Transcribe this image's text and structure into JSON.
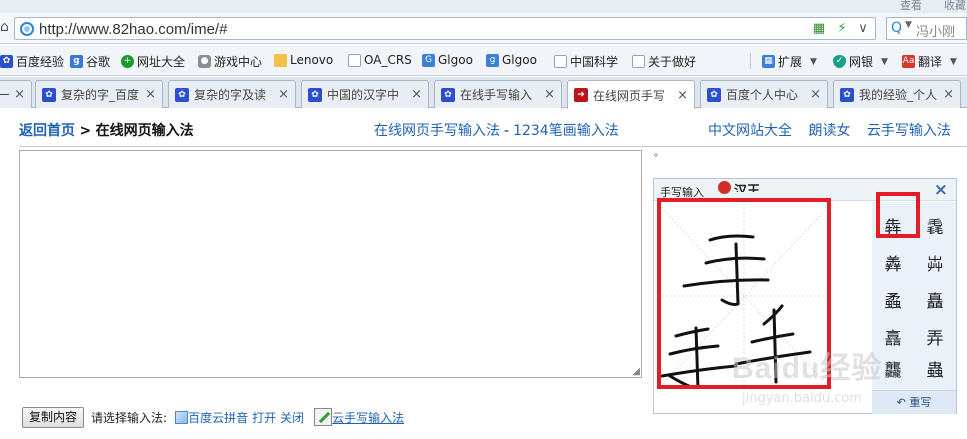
{
  "browser": {
    "title_ghosts": [
      "查看",
      "收藏"
    ],
    "url": "http://www.82hao.com/ime/#",
    "search_query": "冯小刚",
    "bookmarks": [
      "百度经验",
      "谷歌",
      "网址大全",
      "游戏中心",
      "Lenovo",
      "OA_CRS",
      "Glgoo",
      "Glgoo",
      "中国科学",
      "关于做好"
    ],
    "toolbar_items": [
      "扩展",
      "网银",
      "翻译"
    ],
    "tabs": [
      "复杂的字_百度",
      "复杂的字及读",
      "中国的汉字中",
      "在线手写输入",
      "在线网页手写",
      "百度个人中心",
      "我的经验_个人"
    ],
    "active_tab_index": 4
  },
  "page": {
    "breadcrumb_home": "返回首页",
    "breadcrumb_sep": ">",
    "breadcrumb_current": "在线网页输入法",
    "mid_link_1": "在线网页手写输入法",
    "mid_sep": "-",
    "mid_link_2": "1234笔画输入法",
    "right_links": [
      "中文网站大全",
      "朗读女",
      "云手写输入法"
    ],
    "dot": "。",
    "copy_button": "复制内容",
    "choose_label": "请选择输入法:",
    "baidu_pinyin": "百度云拼音",
    "open_label": "打开",
    "close_label": "关闭",
    "cloud_handwriting": "云手写输入法"
  },
  "handwriting_panel": {
    "title": "手写输入",
    "logo_text": "汉王",
    "close": "×",
    "candidates": [
      "犇",
      "毳",
      "羴",
      "芔",
      "蟊",
      "矗",
      "譶",
      "弄",
      "龘",
      "蟲"
    ],
    "selected_index": 0,
    "rewrite": "重写"
  },
  "watermark": {
    "big": "Baidu经验",
    "small": "jingyan.baidu.com"
  },
  "colors": {
    "link": "#1f63b4",
    "highlight_red": "#e21d25"
  }
}
